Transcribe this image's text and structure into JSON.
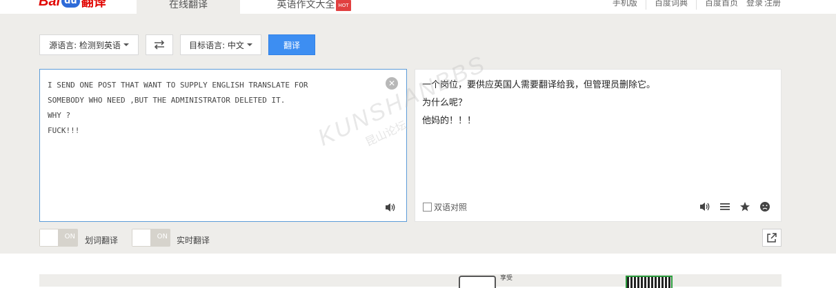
{
  "header": {
    "logo_bai": "Bai",
    "logo_du": "du",
    "logo_cn": "翻译",
    "tabs": [
      {
        "label": "在线翻译",
        "active": true
      },
      {
        "label": "英语作文大全",
        "badge": "HOT"
      }
    ],
    "links": [
      "手机版",
      "百度词典",
      "百度首页",
      "登录",
      "注册"
    ]
  },
  "toolbar": {
    "source_lang": "源语言: 检测到英语",
    "target_lang": "目标语言: 中文",
    "translate_label": "翻译"
  },
  "source": {
    "text": "I SEND ONE POST THAT WANT TO SUPPLY ENGLISH TRANSLATE FOR\nSOMEBODY WHO NEED ,BUT THE ADMINISTRATOR DELETED IT.\nWHY ?\nFUCK!!!"
  },
  "target": {
    "lines": [
      "一个岗位，要供应英国人需要翻译给我，但管理员删除它。",
      "为什么呢？",
      "他妈的！！！"
    ],
    "bilingual_label": "双语对照"
  },
  "options": {
    "toggle_on_label": "ON",
    "word_select_label": "划词翻译",
    "realtime_label": "实时翻译"
  },
  "watermark": {
    "cn": "昆山论坛",
    "en": "KUNSHANBBS"
  },
  "banner": {
    "text": "享受"
  },
  "colors": {
    "accent": "#3d8ef2",
    "brand_red": "#e10602",
    "background": "#eeedea"
  }
}
